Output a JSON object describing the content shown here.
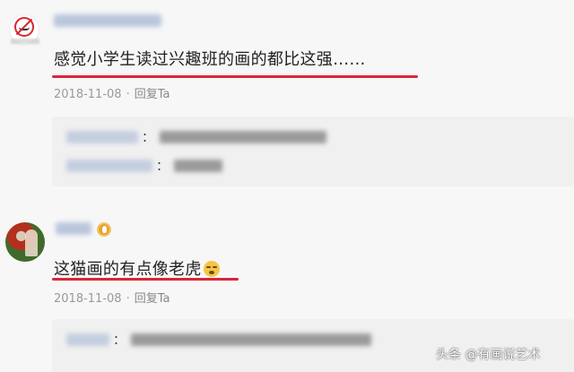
{
  "comments": [
    {
      "text": "感觉小学生读过兴趣班的画的都比这强……",
      "date": "2018-11-08",
      "separator": "·",
      "reply_label": "回复Ta",
      "avatar_icon": "no-bicycle-sign-avatar"
    },
    {
      "text": "这猫画的有点像老虎",
      "emoji_icon": "hushed-face-emoji",
      "date": "2018-11-08",
      "separator": "·",
      "reply_label": "回复Ta",
      "avatar_icon": "photo-avatar",
      "badge_icon": "flame-badge-icon"
    }
  ],
  "reply_colon": "：",
  "watermark": "头条 @有画说艺术",
  "colors": {
    "underline": "#d9263a",
    "meta_text": "#999999",
    "badge": "#e7a232",
    "background": "#f7f7f7"
  }
}
